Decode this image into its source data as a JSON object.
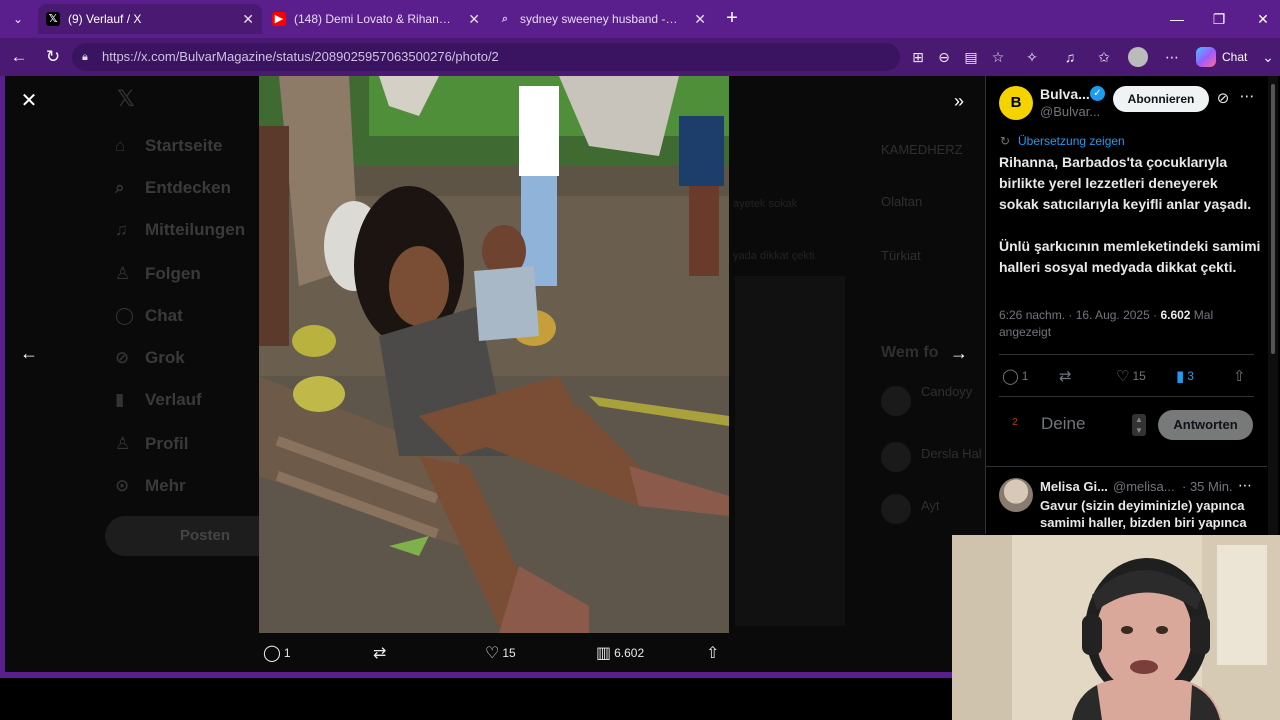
{
  "browser": {
    "tabs": [
      {
        "title": "(9) Verlauf / X",
        "favicon": "x-logo",
        "active": true
      },
      {
        "title": "(148) Demi Lovato & Rihanna - Sta",
        "favicon": "youtube-logo",
        "active": false
      },
      {
        "title": "sydney sweeney husband - Suche",
        "favicon": "search-icon",
        "active": false
      }
    ],
    "url": "https://x.com/BulvarMagazine/status/2089025957063500276/photo/2",
    "chat_label": "Chat"
  },
  "background_app": {
    "nav_items": [
      "Startseite",
      "Entdecken",
      "Mitteilungen",
      "Folgen",
      "Chat",
      "Grok",
      "Verlauf",
      "Profil",
      "Mehr"
    ],
    "post_button": "Posten",
    "right_texts": [
      "KAMEDHERZ",
      "Olaltan",
      "Türkiat",
      "Wem fo",
      "Candoyy",
      "Dersla Hal",
      "Ayt",
      "ayetek sokak",
      "yada dikkat çekti."
    ]
  },
  "photo_actions": {
    "replies": "1",
    "reposts": "",
    "likes": "15",
    "views": "6.602"
  },
  "tweet": {
    "author_name": "Bulva...",
    "author_handle": "@Bulvar...",
    "avatar_letter": "B",
    "follow_label": "Abonnieren",
    "translate_label": "Übersetzung zeigen",
    "paragraphs": [
      "Rihanna, Barbados'ta çocuklarıyla birlikte yerel lezzetleri deneyerek sokak satıcılarıyla keyifli anlar yaşadı.",
      "Ünlü şarkıcının memleketindeki samimi halleri sosyal medyada dikkat çekti."
    ],
    "time": "6:26 nachm. · 16. Aug. 2025 · ",
    "views_count": "6.602",
    "views_suffix": " Mal angezeigt",
    "stats": {
      "replies": "1",
      "reposts": "",
      "likes": "15",
      "bookmarks": "3"
    },
    "reply_avatar": "2",
    "reply_placeholder": "Deine",
    "reply_button": "Antworten"
  },
  "comment": {
    "name": "Melisa Gi...",
    "handle": "@melisa...",
    "time": "· 35 Min.",
    "text": "Gavur (sizin deyiminizle) yapınca samimi haller, bizden biri yapınca o..."
  },
  "colors": {
    "browser_purple": "#5a1f8c",
    "x_blue": "#1d9bf0",
    "avatar_yellow": "#f5d300"
  }
}
